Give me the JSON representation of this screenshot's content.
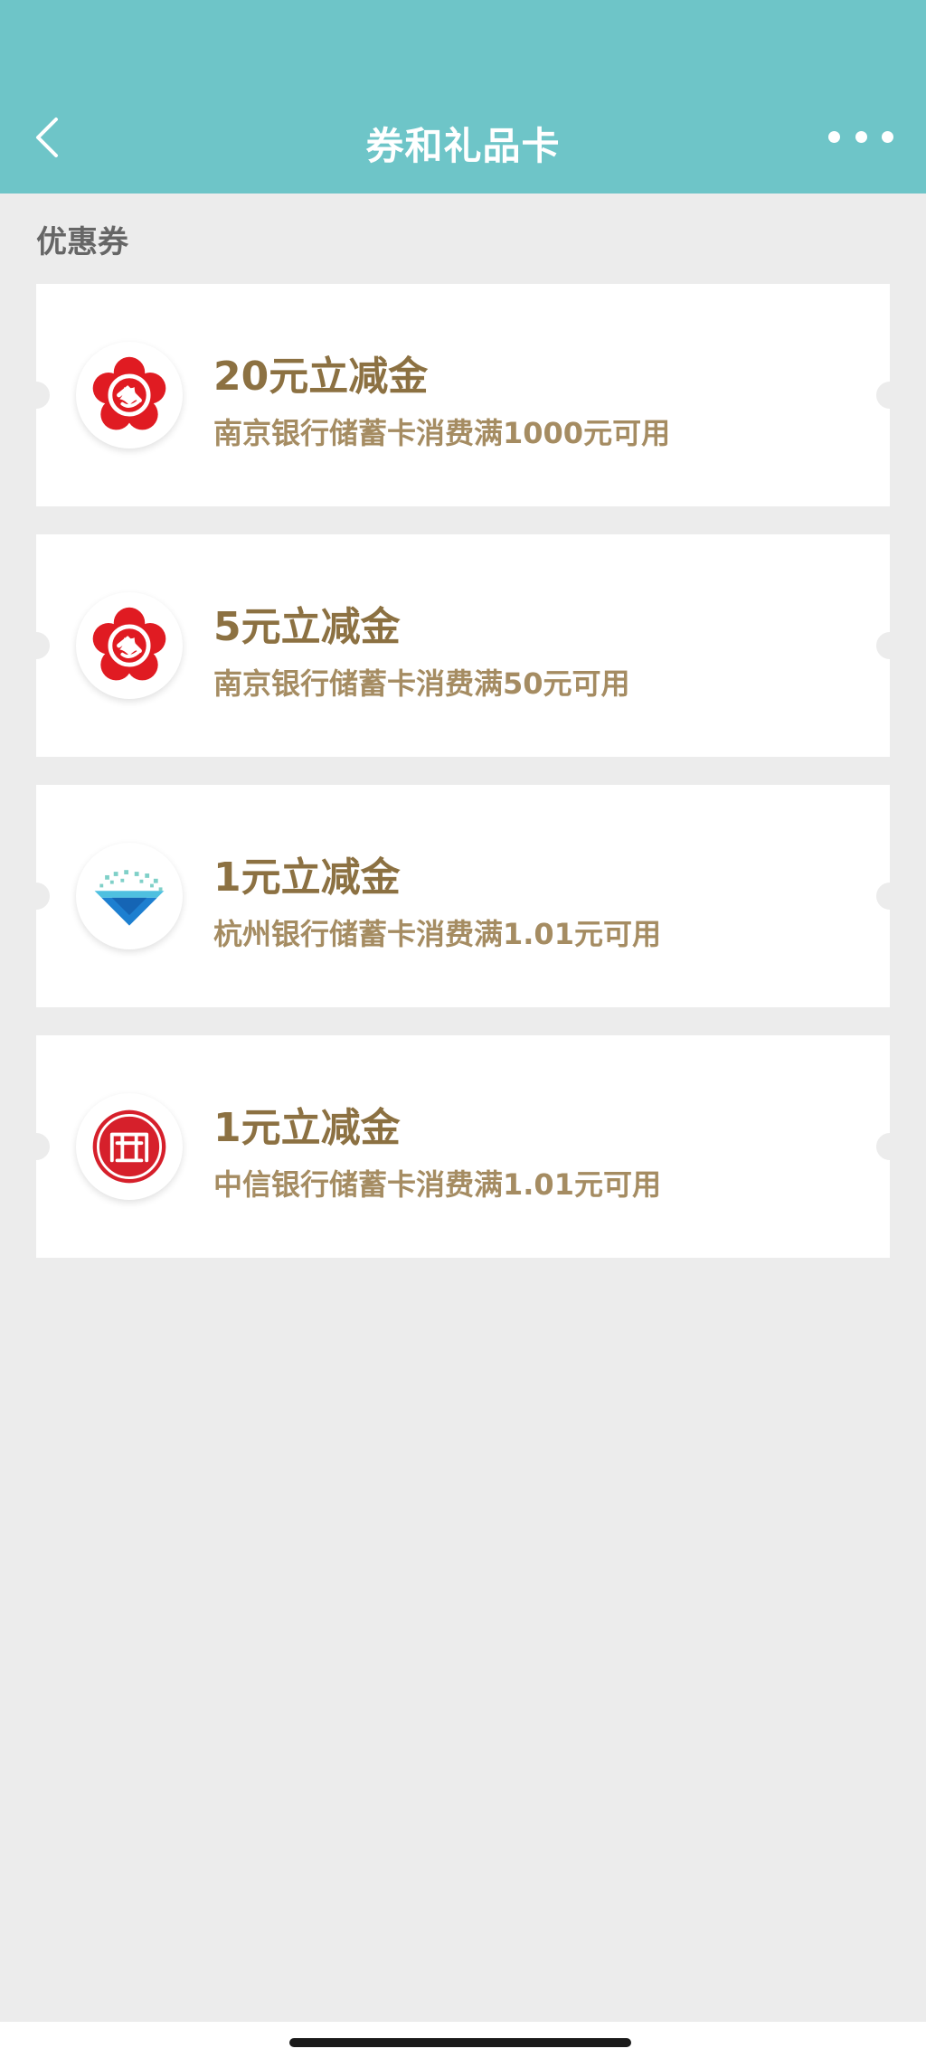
{
  "header": {
    "title": "券和礼品卡",
    "back_icon": "chevron-left-icon",
    "more_icon": "more-dots-icon",
    "bg_color": "#6ec5c8"
  },
  "section": {
    "label": "优惠券"
  },
  "coupons": [
    {
      "amount": "20元立减金",
      "condition": "南京银行储蓄卡消费满1000元可用",
      "logo_icon": "bank-of-nanjing-logo-icon"
    },
    {
      "amount": "5元立减金",
      "condition": "南京银行储蓄卡消费满50元可用",
      "logo_icon": "bank-of-nanjing-logo-icon"
    },
    {
      "amount": "1元立减金",
      "condition": "杭州银行储蓄卡消费满1.01元可用",
      "logo_icon": "bank-of-hangzhou-logo-icon"
    },
    {
      "amount": "1元立减金",
      "condition": "中信银行储蓄卡消费满1.01元可用",
      "logo_icon": "citic-bank-logo-icon"
    }
  ],
  "colors": {
    "amount_text": "#8c7142",
    "condition_text": "#a58c62",
    "page_bg": "#ececec"
  }
}
